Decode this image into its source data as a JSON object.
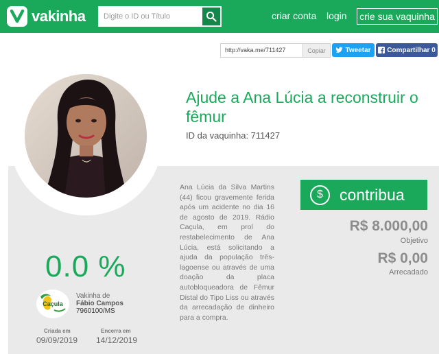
{
  "header": {
    "brand": "vakinha",
    "search_placeholder": "Digite o ID ou Título",
    "nav": {
      "create_account": "criar conta",
      "login": "login",
      "create_campaign": "crie sua vaquinha"
    }
  },
  "share": {
    "url": "http://vaka.me/711427",
    "copy_label": "Copiar",
    "tweet_label": "Tweetar",
    "facebook_label": "Compartilhar 0"
  },
  "campaign": {
    "title": "Ajude a Ana Lúcia a reconstruir o fêmur",
    "id_text": "ID da vaquinha: 711427",
    "description": "Ana Lúcia da Silva Martins (44) ficou gravemente ferida após um acidente no dia 16 de agosto de 2019. Rádio Caçula, em prol do restabelecimento de Ana Lúcia, está solicitando a ajuda da população três-lagoense ou através de uma doação da placa autobloqueadora de Fêmur Distal do Tipo Liss ou através da arrecadação de dinheiro para a compra.",
    "contribute_label": "contribua",
    "goal_amount": "R$ 8.000,00",
    "goal_label": "Objetivo",
    "raised_amount": "R$ 0,00",
    "raised_label": "Arrecadado",
    "progress_percent": "0.0 %",
    "owner_prefix": "Vakinha de",
    "owner_name": "Fábio Campos",
    "owner_id": "7960100/MS",
    "org_logo_text": "Caçula",
    "created_label": "Criada em",
    "created_date": "09/09/2019",
    "ends_label": "Encerra em",
    "ends_date": "14/12/2019"
  },
  "colors": {
    "brand_green": "#1aa95b",
    "twitter_blue": "#1da1f2",
    "facebook_blue": "#3b5998",
    "panel_grey": "#eaeaea"
  },
  "icons": [
    "vakinha-logo-icon",
    "search-icon",
    "twitter-bird-icon",
    "facebook-icon",
    "dollar-icon"
  ]
}
